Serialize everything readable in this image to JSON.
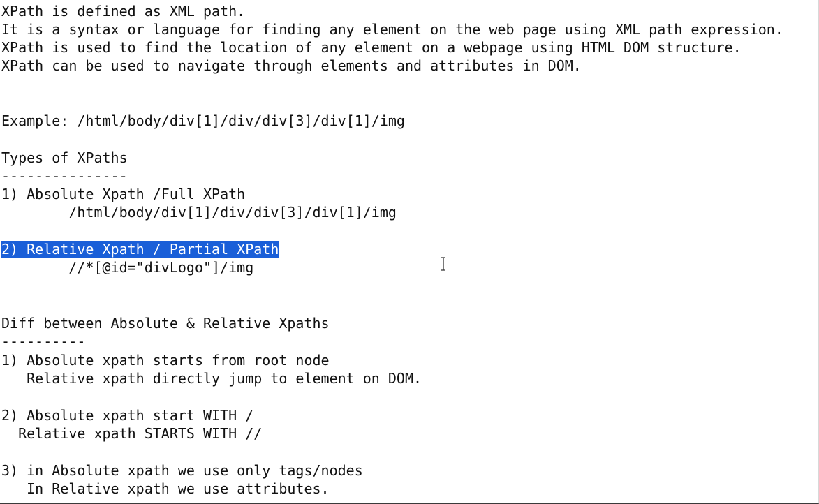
{
  "lines": [
    "XPath is defined as XML path.",
    "It is a syntax or language for finding any element on the web page using XML path expression.",
    "XPath is used to find the location of any element on a webpage using HTML DOM structure.",
    "XPath can be used to navigate through elements and attributes in DOM.",
    "Example: /html/body/div[1]/div/div[3]/div[1]/img",
    "Types of XPaths",
    "---------------",
    "1) Absolute Xpath /Full XPath",
    "        /html/body/div[1]/div/div[3]/div[1]/img",
    "2) Relative Xpath / Partial XPath",
    "        //*[@id=\"divLogo\"]/img",
    "Diff between Absolute & Relative Xpaths",
    "----------",
    "1) Absolute xpath starts from root node",
    "   Relative xpath directly jump to element on DOM.",
    "2) Absolute xpath start WITH /",
    "  Relative xpath STARTS WITH //",
    "3) in Absolute xpath we use only tags/nodes",
    "   In Relative xpath we use attributes."
  ],
  "selected_line_index": 9,
  "colors": {
    "text": "#111111",
    "selection_bg": "#1a5fd8",
    "selection_text": "#ffffff",
    "background": "#ffffff"
  },
  "cursor_icon": "text-cursor-icon"
}
